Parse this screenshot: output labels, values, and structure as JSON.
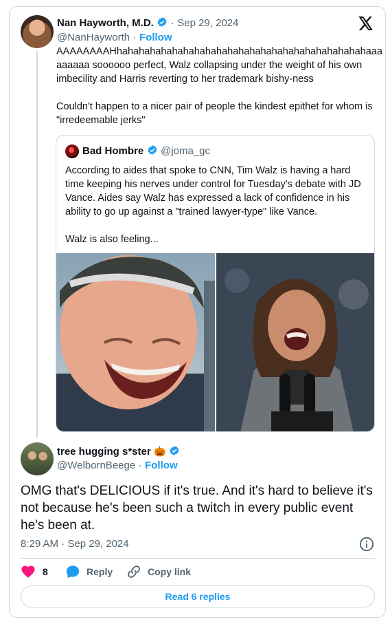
{
  "tweet": {
    "author_name": "Nan Hayworth, M.D.",
    "date": "Sep 29, 2024",
    "handle": "@NanHayworth",
    "follow_label": "Follow",
    "text": "AAAAAAAAHhahahahahahahahahahahahahahahahahahahahahahahaaa aaaaaa soooooo perfect, Walz collapsing under the weight of his own imbecility and Harris reverting to her trademark bishy-ness\n\nCouldn't happen to a nicer pair of people the kindest epithet for whom is \"irredeemable jerks\""
  },
  "quote": {
    "author_name": "Bad Hombre",
    "handle": "@joma_gc",
    "text": "According to aides that spoke to CNN, Tim Walz is having a hard time keeping his nerves under control for Tuesday's debate with JD Vance. Aides say Walz has expressed a lack of confidence in his ability to go up against a \"trained lawyer-type\" like Vance.\n\nWalz is also feeling..."
  },
  "reply": {
    "author_name": "tree hugging s*ster",
    "emoji": "🎃",
    "handle": "@WelbornBeege",
    "follow_label": "Follow",
    "text": "OMG that's DELICIOUS if it's true. And it's hard to believe it's not because he's been such a twitch in every public event he's been at.",
    "timestamp": "8:29 AM · Sep 29, 2024",
    "likes": "8",
    "reply_label": "Reply",
    "copy_link_label": "Copy link",
    "read_replies_label": "Read 6 replies"
  },
  "colors": {
    "accent": "#1d9bf0",
    "like": "#f91880",
    "border": "#cfd9de",
    "text": "#0f1419",
    "muted": "#536471"
  },
  "icons": [
    "x-logo-icon",
    "verified-badge-icon",
    "info-icon",
    "heart-icon",
    "reply-bubble-icon",
    "link-icon"
  ]
}
